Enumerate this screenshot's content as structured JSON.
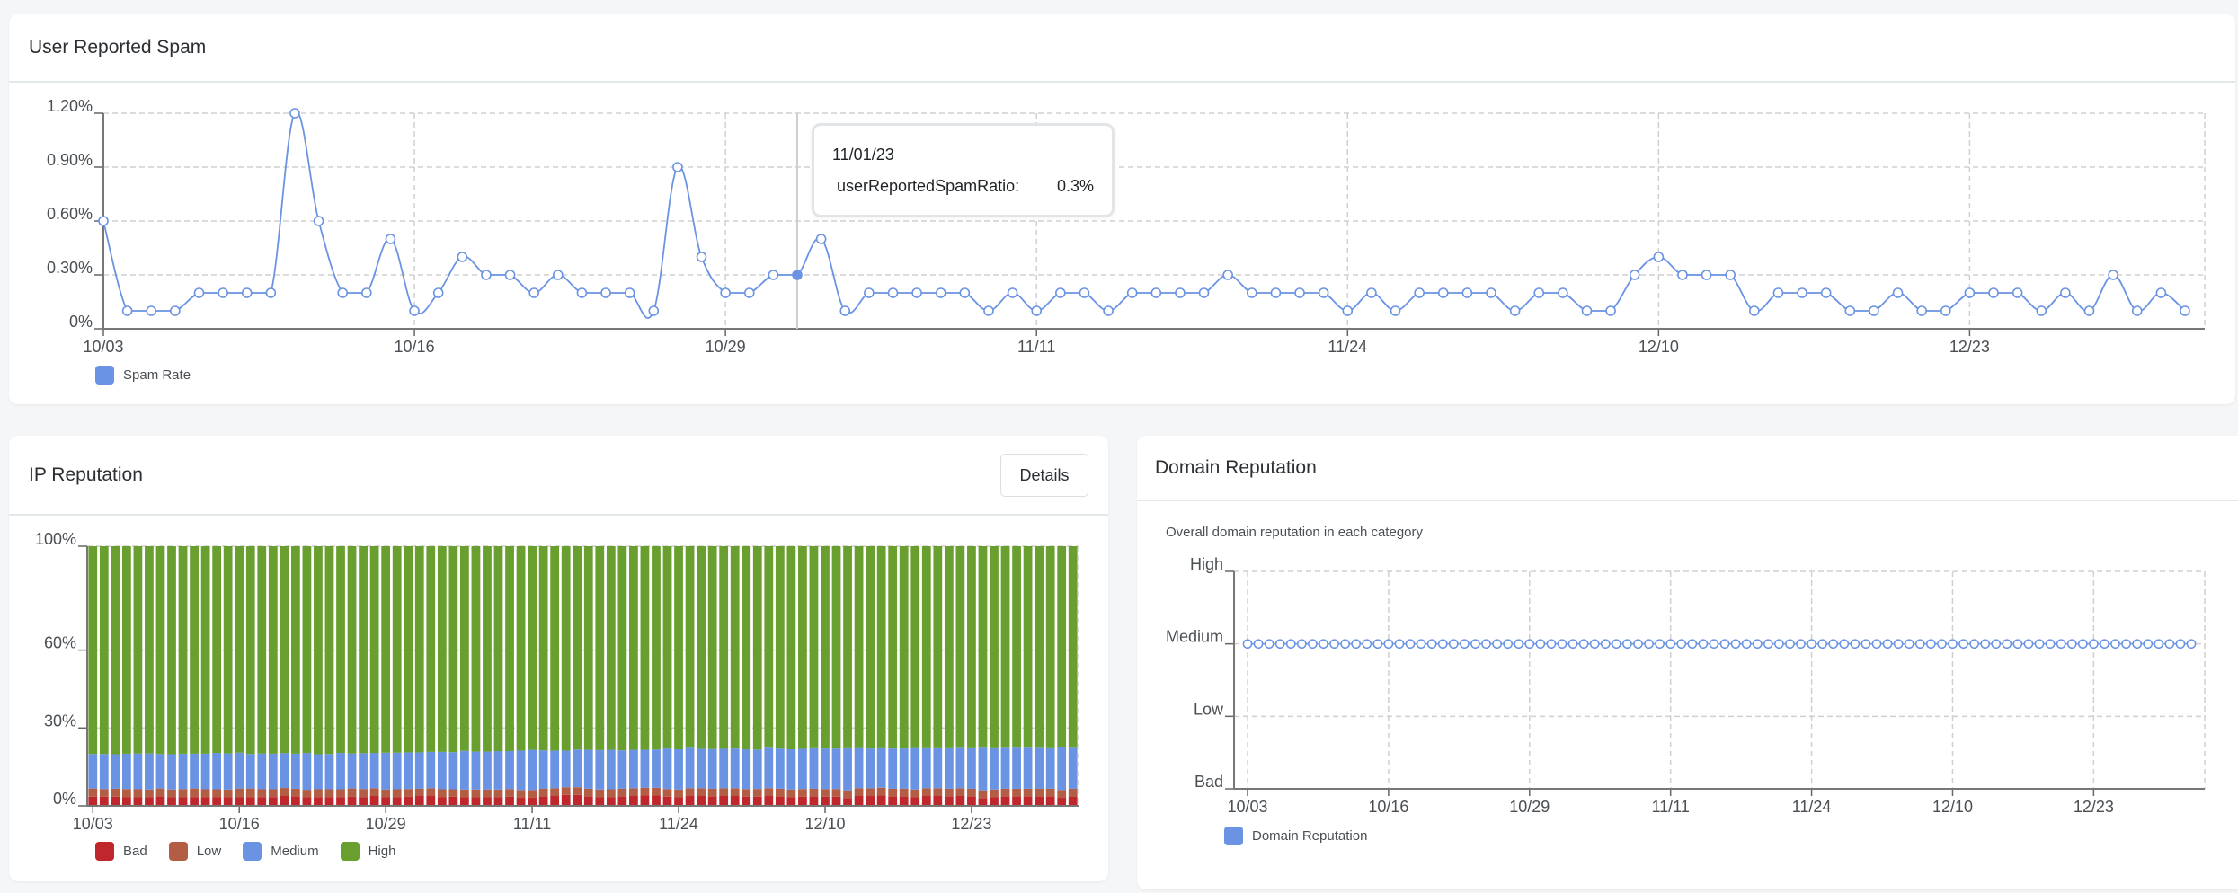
{
  "spam_panel": {
    "title": "User Reported Spam",
    "legend": [
      {
        "label": "Spam Rate",
        "color": "#6a93e3"
      }
    ],
    "tooltip": {
      "date": "11/01/23",
      "key": "userReportedSpamRatio:",
      "value": "0.3%",
      "index": 29
    }
  },
  "ip_panel": {
    "title": "IP Reputation",
    "details_label": "Details",
    "legend": [
      {
        "label": "Bad",
        "color": "#c0272d"
      },
      {
        "label": "Low",
        "color": "#b35e44"
      },
      {
        "label": "Medium",
        "color": "#6a93e3"
      },
      {
        "label": "High",
        "color": "#689f2f"
      }
    ]
  },
  "domain_panel": {
    "title": "Domain Reputation",
    "subtitle": "Overall domain reputation in each category",
    "legend": [
      {
        "label": "Domain Reputation",
        "color": "#6a93e3"
      }
    ]
  },
  "chart_data": [
    {
      "id": "spam",
      "type": "line",
      "title": "User Reported Spam",
      "xlabel": "",
      "ylabel": "",
      "x_tick_labels": [
        "10/03",
        "10/16",
        "10/29",
        "11/11",
        "11/24",
        "12/10",
        "12/23"
      ],
      "x_tick_every": 13,
      "yticks": [
        "0%",
        "0.30%",
        "0.60%",
        "0.90%",
        "1.20%"
      ],
      "ytick_values": [
        0,
        0.3,
        0.6,
        0.9,
        1.2
      ],
      "ylim": [
        0,
        1.2
      ],
      "grid": true,
      "legend_position": "bottom-left",
      "series": [
        {
          "name": "Spam Rate",
          "color": "#6a93e3",
          "values": [
            0.6,
            0.1,
            0.1,
            0.1,
            0.2,
            0.2,
            0.2,
            0.2,
            1.2,
            0.6,
            0.2,
            0.2,
            0.5,
            0.1,
            0.2,
            0.4,
            0.3,
            0.3,
            0.2,
            0.3,
            0.2,
            0.2,
            0.2,
            0.1,
            0.9,
            0.4,
            0.2,
            0.2,
            0.3,
            0.3,
            0.5,
            0.1,
            0.2,
            0.2,
            0.2,
            0.2,
            0.2,
            0.1,
            0.2,
            0.1,
            0.2,
            0.2,
            0.1,
            0.2,
            0.2,
            0.2,
            0.2,
            0.3,
            0.2,
            0.2,
            0.2,
            0.2,
            0.1,
            0.2,
            0.1,
            0.2,
            0.2,
            0.2,
            0.2,
            0.1,
            0.2,
            0.2,
            0.1,
            0.1,
            0.3,
            0.4,
            0.3,
            0.3,
            0.3,
            0.1,
            0.2,
            0.2,
            0.2,
            0.1,
            0.1,
            0.2,
            0.1,
            0.1,
            0.2,
            0.2,
            0.2,
            0.1,
            0.2,
            0.1,
            0.3,
            0.1,
            0.2,
            0.1
          ]
        }
      ]
    },
    {
      "id": "ip",
      "type": "bar",
      "stacked": true,
      "title": "IP Reputation",
      "x_tick_labels": [
        "10/03",
        "10/16",
        "10/29",
        "11/11",
        "11/24",
        "12/10",
        "12/23"
      ],
      "x_tick_every": 13,
      "yticks": [
        "0%",
        "30%",
        "60%",
        "100%"
      ],
      "ytick_values": [
        0,
        30,
        60,
        100
      ],
      "ylim": [
        0,
        100
      ],
      "legend_position": "bottom-left",
      "series": [
        {
          "name": "Bad",
          "color": "#c0272d",
          "values": [
            3.5,
            3.5,
            3.5,
            3.3,
            3.3,
            3.3,
            3.6,
            3.3,
            3.3,
            3.4,
            3.3,
            3.3,
            3.3,
            3.3,
            3.4,
            3.4,
            3.4,
            3.8,
            3.6,
            3.3,
            3.4,
            3.4,
            3.4,
            3.5,
            3.4,
            3.8,
            3.3,
            3.3,
            3.5,
            3.8,
            3.8,
            3.3,
            3.5,
            3.3,
            3.3,
            3.3,
            3.4,
            3.5,
            3.1,
            3.1,
            3.6,
            3.8,
            4.2,
            4.2,
            3.6,
            3.3,
            3.4,
            3.6,
            3.8,
            4.0,
            4.0,
            3.5,
            3.3,
            3.8,
            3.8,
            3.6,
            3.8,
            3.8,
            3.5,
            3.5,
            3.8,
            3.6,
            3.3,
            3.5,
            3.6,
            3.5,
            3.5,
            3.0,
            3.8,
            3.8,
            4.0,
            3.6,
            3.6,
            3.3,
            3.8,
            3.8,
            3.6,
            3.8,
            3.6,
            3.0,
            3.3,
            3.6,
            3.6,
            3.6,
            3.6,
            3.6,
            3.1,
            3.6
          ]
        },
        {
          "name": "Low",
          "color": "#b35e44",
          "values": [
            3.2,
            3.0,
            3.1,
            3.2,
            3.1,
            3.0,
            3.1,
            3.0,
            3.2,
            3.3,
            3.1,
            3.1,
            3.0,
            3.3,
            3.3,
            3.0,
            3.0,
            3.1,
            3.0,
            2.9,
            3.0,
            3.0,
            3.0,
            3.2,
            3.1,
            3.0,
            3.0,
            3.1,
            3.0,
            2.8,
            3.0,
            3.1,
            2.9,
            3.0,
            3.0,
            3.0,
            2.9,
            3.0,
            3.0,
            3.0,
            3.0,
            3.0,
            3.0,
            3.0,
            3.0,
            3.0,
            3.0,
            3.0,
            3.0,
            3.0,
            3.0,
            3.0,
            3.0,
            3.0,
            3.0,
            3.0,
            3.0,
            3.0,
            3.0,
            3.0,
            3.0,
            3.0,
            3.0,
            3.0,
            3.0,
            3.0,
            3.0,
            3.0,
            3.0,
            3.0,
            3.0,
            3.0,
            3.0,
            3.0,
            3.0,
            3.0,
            3.0,
            3.0,
            3.0,
            3.0,
            3.0,
            3.0,
            3.0,
            3.0,
            3.0,
            3.0,
            3.0,
            3.0
          ]
        },
        {
          "name": "Medium",
          "color": "#6a93e3",
          "values": [
            13.3,
            13.5,
            13.3,
            13.6,
            13.8,
            13.9,
            13.3,
            13.6,
            13.6,
            13.4,
            13.7,
            14.0,
            13.9,
            13.9,
            13.3,
            13.8,
            13.7,
            13.4,
            13.5,
            14.2,
            13.5,
            13.6,
            14.0,
            13.5,
            13.8,
            13.6,
            14.2,
            14.1,
            14.1,
            14.0,
            14.0,
            14.4,
            14.3,
            14.9,
            14.6,
            14.6,
            14.8,
            14.6,
            15.2,
            15.5,
            14.8,
            14.5,
            14.1,
            14.5,
            15.0,
            15.2,
            15.2,
            14.8,
            14.8,
            14.6,
            14.7,
            15.6,
            15.5,
            15.6,
            15.2,
            15.3,
            15.2,
            15.3,
            15.3,
            15.2,
            15.6,
            15.5,
            15.5,
            15.5,
            15.6,
            15.6,
            15.6,
            16.2,
            15.5,
            15.3,
            15.2,
            15.5,
            15.5,
            16.0,
            15.4,
            15.4,
            15.6,
            15.6,
            15.6,
            16.4,
            15.9,
            15.8,
            15.8,
            15.8,
            15.8,
            15.6,
            16.4,
            15.8
          ]
        },
        {
          "name": "High",
          "color": "#689f2f",
          "values": [
            80.0,
            80.0,
            80.1,
            79.9,
            79.8,
            79.8,
            80.0,
            80.1,
            79.9,
            79.9,
            79.9,
            79.6,
            79.8,
            79.5,
            80.0,
            79.8,
            79.9,
            79.7,
            79.9,
            79.6,
            80.1,
            80.0,
            79.6,
            79.8,
            79.7,
            79.6,
            79.5,
            79.5,
            79.4,
            79.4,
            79.2,
            79.2,
            79.3,
            78.8,
            79.1,
            79.1,
            78.9,
            78.9,
            78.7,
            78.4,
            78.6,
            78.7,
            78.7,
            78.3,
            78.4,
            78.5,
            78.4,
            78.6,
            78.4,
            78.4,
            78.3,
            77.9,
            78.2,
            77.6,
            78.0,
            78.1,
            78.0,
            77.9,
            78.2,
            78.3,
            77.6,
            77.9,
            78.2,
            78.0,
            77.8,
            77.9,
            77.9,
            77.8,
            77.7,
            77.9,
            77.8,
            77.9,
            77.9,
            77.7,
            77.8,
            77.8,
            77.8,
            77.6,
            77.8,
            77.6,
            77.8,
            77.6,
            77.6,
            77.6,
            77.6,
            77.8,
            77.5,
            77.6
          ]
        }
      ]
    },
    {
      "id": "domain",
      "type": "line",
      "title": "Domain Reputation",
      "subtitle": "Overall domain reputation in each category",
      "x_tick_labels": [
        "10/03",
        "10/16",
        "10/29",
        "11/11",
        "11/24",
        "12/10",
        "12/23"
      ],
      "x_tick_every": 13,
      "yticks": [
        "Bad",
        "Low",
        "Medium",
        "High"
      ],
      "ytick_values": [
        0,
        1,
        2,
        3
      ],
      "ylim": [
        0,
        3
      ],
      "grid": true,
      "legend_position": "bottom-left",
      "series": [
        {
          "name": "Domain Reputation",
          "color": "#6a93e3",
          "category": "Medium",
          "values": [
            2,
            2,
            2,
            2,
            2,
            2,
            2,
            2,
            2,
            2,
            2,
            2,
            2,
            2,
            2,
            2,
            2,
            2,
            2,
            2,
            2,
            2,
            2,
            2,
            2,
            2,
            2,
            2,
            2,
            2,
            2,
            2,
            2,
            2,
            2,
            2,
            2,
            2,
            2,
            2,
            2,
            2,
            2,
            2,
            2,
            2,
            2,
            2,
            2,
            2,
            2,
            2,
            2,
            2,
            2,
            2,
            2,
            2,
            2,
            2,
            2,
            2,
            2,
            2,
            2,
            2,
            2,
            2,
            2,
            2,
            2,
            2,
            2,
            2,
            2,
            2,
            2,
            2,
            2,
            2,
            2,
            2,
            2,
            2,
            2,
            2,
            2,
            2
          ]
        }
      ]
    }
  ]
}
